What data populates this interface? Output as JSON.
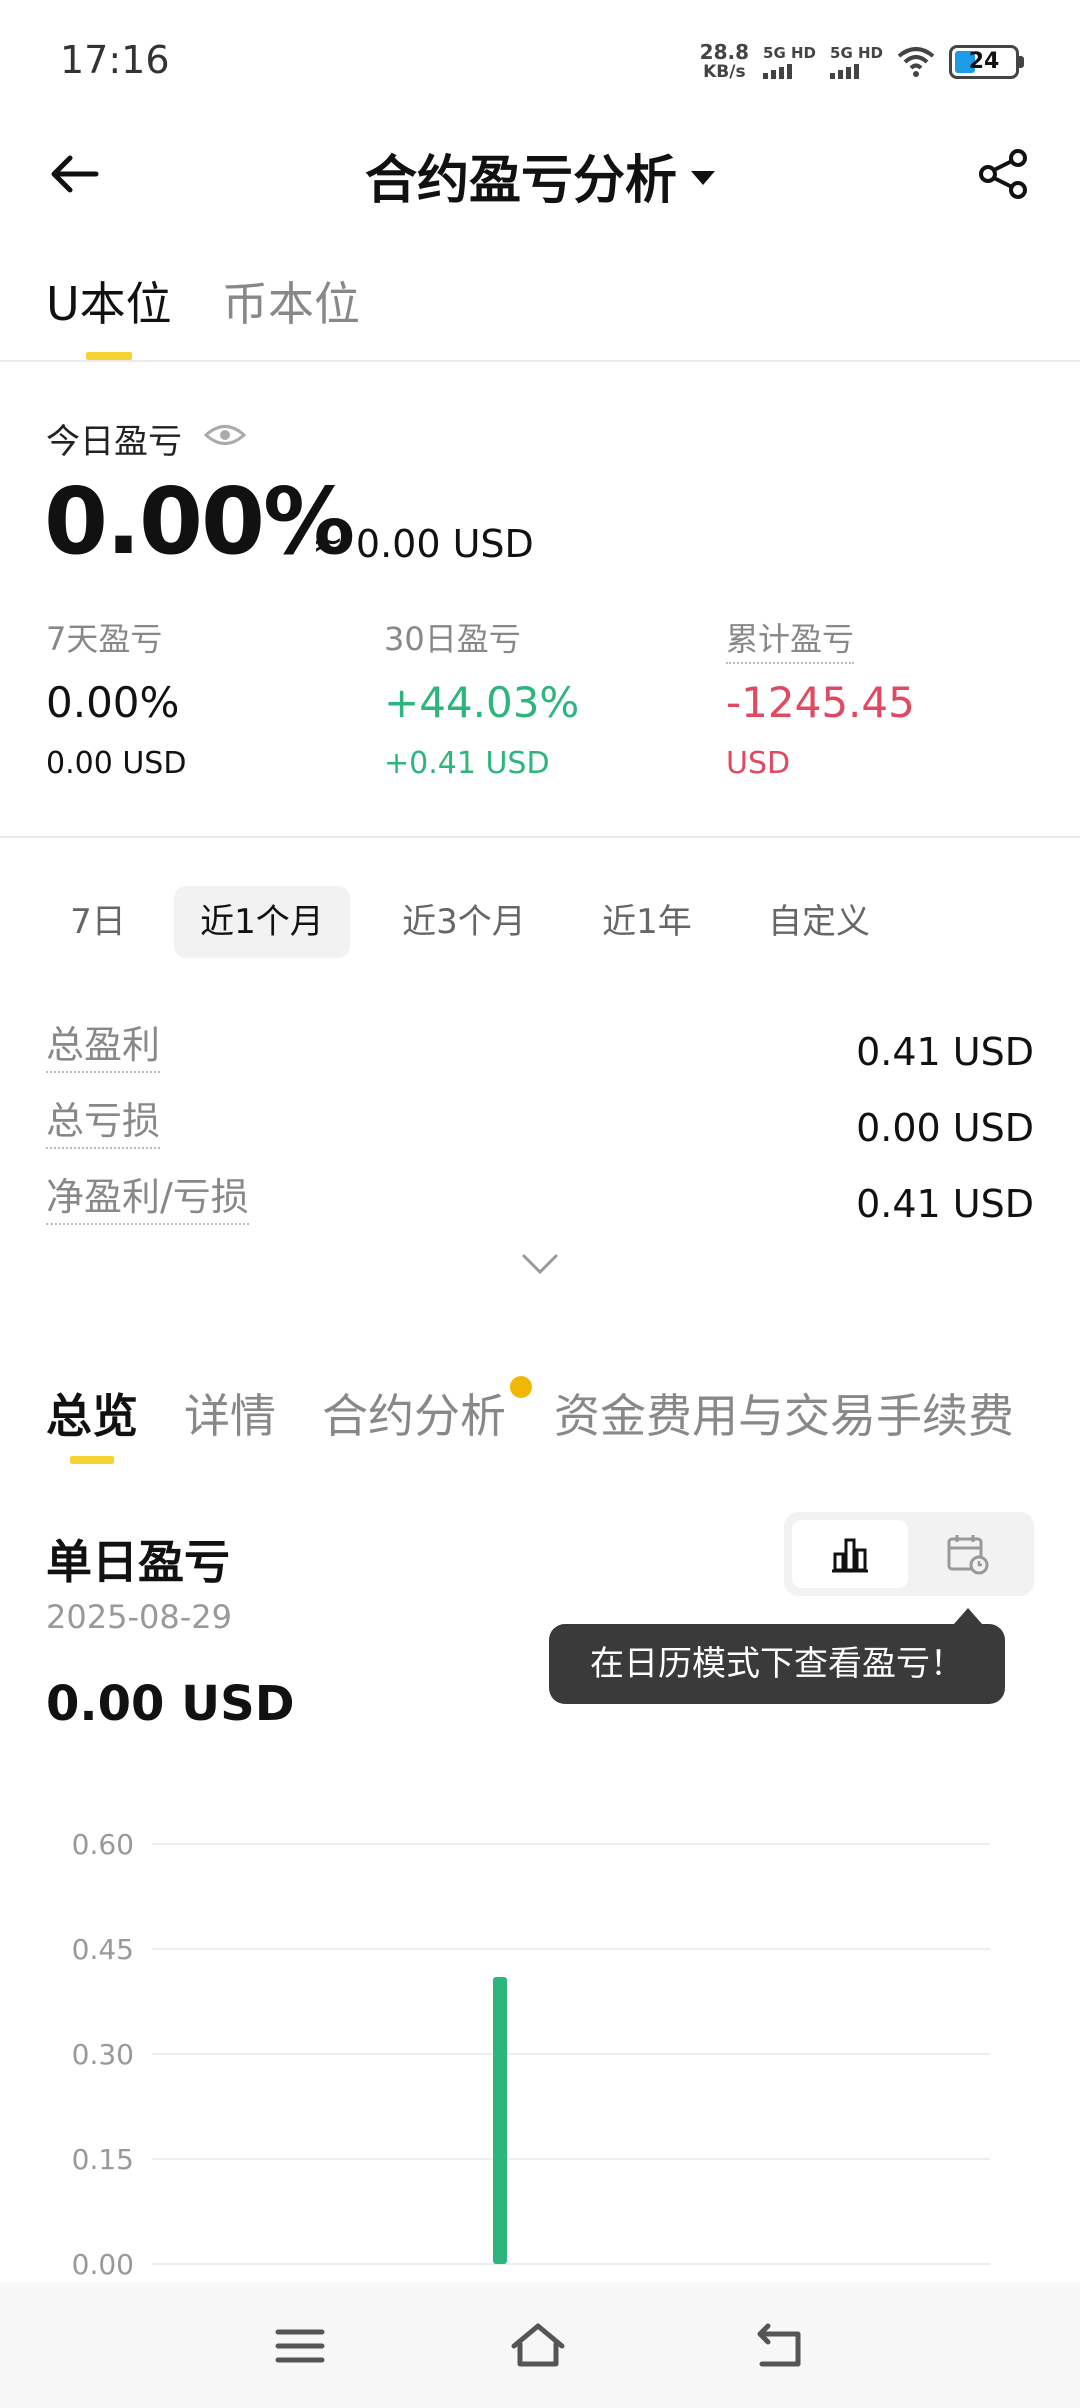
{
  "status": {
    "time": "17:16",
    "speed_value": "28.8",
    "speed_unit": "KB/s",
    "sim1": "5G HD",
    "sim2": "5G HD",
    "battery": "24"
  },
  "header": {
    "title": "合约盈亏分析"
  },
  "tabs": [
    "U本位",
    "币本位"
  ],
  "today": {
    "label": "今日盈亏",
    "percent": "0.00%",
    "approx": "≈ 0.00 USD"
  },
  "summary": [
    {
      "label": "7天盈亏",
      "value": "0.00%",
      "sub": "0.00 USD"
    },
    {
      "label": "30日盈亏",
      "value": "+44.03%",
      "sub": "+0.41 USD"
    },
    {
      "label": "累计盈亏",
      "value": "-1245.45",
      "sub": "USD"
    }
  ],
  "periods": [
    "7日",
    "近1个月",
    "近3个月",
    "近1年",
    "自定义"
  ],
  "rows": [
    {
      "label": "总盈利",
      "value": "0.41 USD"
    },
    {
      "label": "总亏损",
      "value": "0.00 USD"
    },
    {
      "label": "净盈利/亏损",
      "value": "0.41 USD"
    }
  ],
  "section_tabs": [
    "总览",
    "详情",
    "合约分析",
    "资金费用与交易手续费"
  ],
  "daily": {
    "title": "单日盈亏",
    "date": "2025-08-29",
    "value": "0.00 USD"
  },
  "tooltip": "在日历模式下查看盈亏！",
  "colors": {
    "accent": "#f6d232",
    "positive": "#2db67c",
    "negative": "#e0495f",
    "badge": "#f2b705"
  },
  "chart_data": {
    "type": "bar",
    "y_ticks": [
      "0.60",
      "0.45",
      "0.30",
      "0.15",
      "0.00"
    ],
    "ylim": [
      0,
      0.6
    ],
    "bars": [
      {
        "x": 0.41,
        "value": 0.41
      }
    ],
    "color": "#2db67c"
  }
}
